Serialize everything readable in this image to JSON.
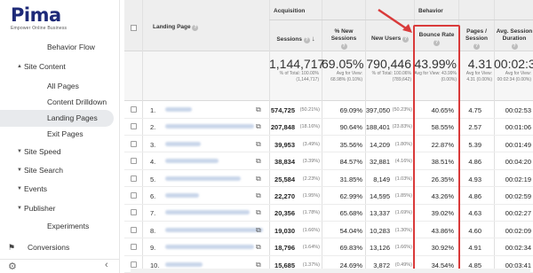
{
  "brand": {
    "name": "Pima",
    "tagline": "Empower Online Business",
    "accent": "#e8a316",
    "color": "#1e2a78"
  },
  "sidebar": {
    "items": [
      {
        "label": "Behavior Flow",
        "level": 1
      },
      {
        "label": "Site Content",
        "level": 0,
        "expanded": true
      },
      {
        "label": "All Pages",
        "level": 1
      },
      {
        "label": "Content Drilldown",
        "level": 1
      },
      {
        "label": "Landing Pages",
        "level": 1,
        "active": true
      },
      {
        "label": "Exit Pages",
        "level": 1
      },
      {
        "label": "Site Speed",
        "level": 0
      },
      {
        "label": "Site Search",
        "level": 0
      },
      {
        "label": "Events",
        "level": 0
      },
      {
        "label": "Publisher",
        "level": 0
      },
      {
        "label": "Experiments",
        "level": 1
      },
      {
        "label": "Conversions",
        "level": 0,
        "icon": "flag-icon"
      }
    ]
  },
  "table": {
    "group_acquisition": "Acquisition",
    "group_behavior": "Behavior",
    "headers": {
      "landing_page": "Landing Page",
      "sessions": "Sessions",
      "new_sessions": "% New Sessions",
      "new_users": "New Users",
      "bounce_rate": "Bounce Rate",
      "pages_session": "Pages / Session",
      "avg_duration": "Avg. Session Duration"
    },
    "totals": {
      "sessions": "1,144,717",
      "sessions_sub": "% of Total: 100.00% (1,144,717)",
      "new_sessions": "69.05%",
      "new_sessions_sub": "Avg for View: 68.98% (0.10%)",
      "new_users": "790,446",
      "new_users_sub": "% of Total: 100.06% (789,642)",
      "bounce_rate": "43.99%",
      "bounce_rate_sub": "Avg for View: 43.99% (0.00%)",
      "pages_session": "4.31",
      "pages_session_sub": "Avg for View: 4.31 (0.00%)",
      "avg_duration": "00:02:34",
      "avg_duration_sub": "Avg for View: 00:02:34 (0.00%)"
    },
    "rows": [
      {
        "n": "1.",
        "sessions": "574,725",
        "sessions_pct": "(50.21%)",
        "new_sessions": "69.09%",
        "new_users": "397,050",
        "new_users_pct": "(50.23%)",
        "bounce_rate": "40.65%",
        "pages": "4.75",
        "duration": "00:02:53"
      },
      {
        "n": "2.",
        "sessions": "207,848",
        "sessions_pct": "(18.16%)",
        "new_sessions": "90.64%",
        "new_users": "188,401",
        "new_users_pct": "(23.83%)",
        "bounce_rate": "58.55%",
        "pages": "2.57",
        "duration": "00:01:06"
      },
      {
        "n": "3.",
        "sessions": "39,953",
        "sessions_pct": "(3.49%)",
        "new_sessions": "35.56%",
        "new_users": "14,209",
        "new_users_pct": "(1.80%)",
        "bounce_rate": "22.87%",
        "pages": "5.39",
        "duration": "00:01:49"
      },
      {
        "n": "4.",
        "sessions": "38,834",
        "sessions_pct": "(3.39%)",
        "new_sessions": "84.57%",
        "new_users": "32,881",
        "new_users_pct": "(4.16%)",
        "bounce_rate": "38.51%",
        "pages": "4.86",
        "duration": "00:04:20"
      },
      {
        "n": "5.",
        "sessions": "25,584",
        "sessions_pct": "(2.23%)",
        "new_sessions": "31.85%",
        "new_users": "8,149",
        "new_users_pct": "(1.03%)",
        "bounce_rate": "26.35%",
        "pages": "4.93",
        "duration": "00:02:19"
      },
      {
        "n": "6.",
        "sessions": "22,270",
        "sessions_pct": "(1.95%)",
        "new_sessions": "62.99%",
        "new_users": "14,595",
        "new_users_pct": "(1.85%)",
        "bounce_rate": "43.26%",
        "pages": "4.86",
        "duration": "00:02:59"
      },
      {
        "n": "7.",
        "sessions": "20,356",
        "sessions_pct": "(1.78%)",
        "new_sessions": "65.68%",
        "new_users": "13,337",
        "new_users_pct": "(1.69%)",
        "bounce_rate": "39.02%",
        "pages": "4.63",
        "duration": "00:02:27"
      },
      {
        "n": "8.",
        "sessions": "19,030",
        "sessions_pct": "(1.66%)",
        "new_sessions": "54.04%",
        "new_users": "10,283",
        "new_users_pct": "(1.30%)",
        "bounce_rate": "43.86%",
        "pages": "4.60",
        "duration": "00:02:09"
      },
      {
        "n": "9.",
        "sessions": "18,796",
        "sessions_pct": "(1.64%)",
        "new_sessions": "69.83%",
        "new_users": "13,126",
        "new_users_pct": "(1.66%)",
        "bounce_rate": "30.92%",
        "pages": "4.91",
        "duration": "00:02:34"
      },
      {
        "n": "10.",
        "sessions": "15,685",
        "sessions_pct": "(1.37%)",
        "new_sessions": "24.69%",
        "new_users": "3,872",
        "new_users_pct": "(0.49%)",
        "bounce_rate": "34.54%",
        "pages": "4.85",
        "duration": "00:03:41"
      }
    ]
  },
  "colors": {
    "highlight": "#d93a3a",
    "active_nav": "#e8eaed"
  }
}
